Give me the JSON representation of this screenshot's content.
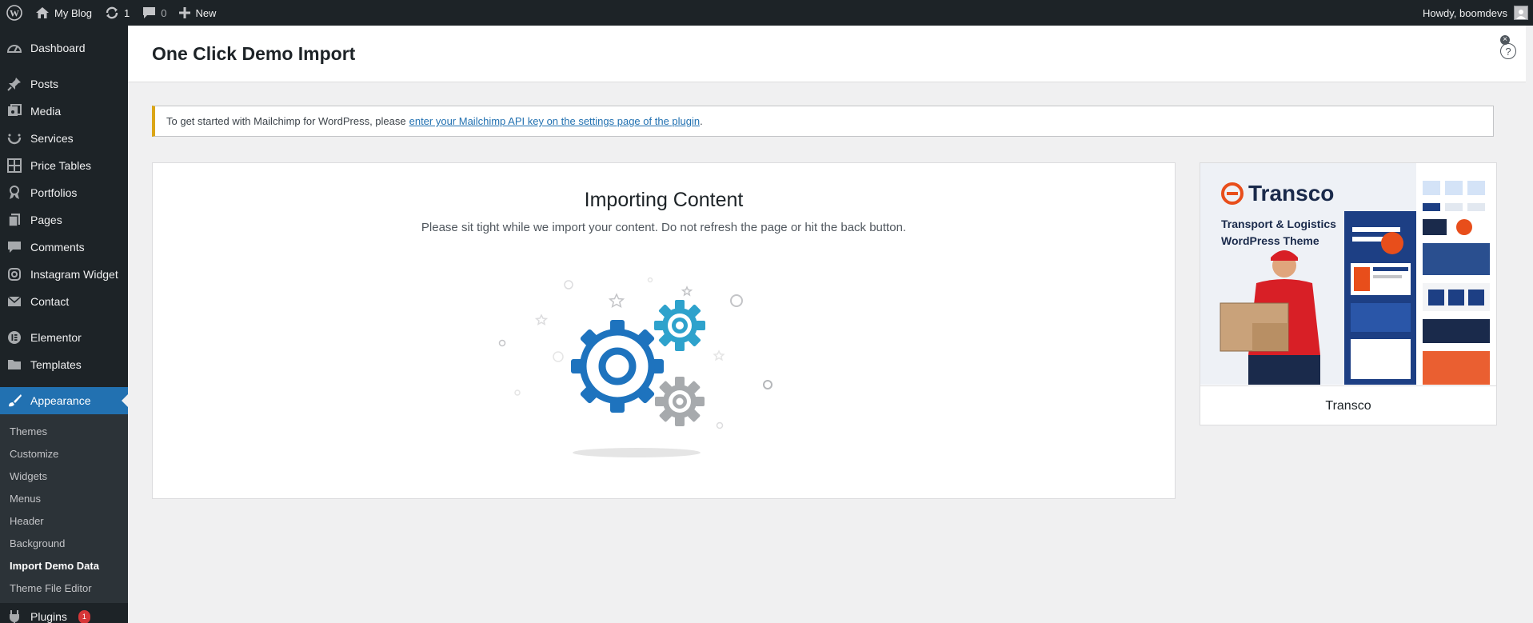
{
  "admin_bar": {
    "site_name": "My Blog",
    "updates_count": "1",
    "comments_count": "0",
    "new_label": "New",
    "howdy": "Howdy, boomdevs"
  },
  "sidebar": {
    "items": [
      {
        "label": "Dashboard",
        "icon": "dashboard-icon"
      },
      {
        "label": "Posts",
        "icon": "pin-icon"
      },
      {
        "label": "Media",
        "icon": "media-icon"
      },
      {
        "label": "Services",
        "icon": "services-icon"
      },
      {
        "label": "Price Tables",
        "icon": "grid-icon"
      },
      {
        "label": "Portfolios",
        "icon": "award-icon"
      },
      {
        "label": "Pages",
        "icon": "pages-icon"
      },
      {
        "label": "Comments",
        "icon": "comment-icon"
      },
      {
        "label": "Instagram Widget",
        "icon": "instagram-icon"
      },
      {
        "label": "Contact",
        "icon": "mail-icon"
      },
      {
        "label": "Elementor",
        "icon": "elementor-icon"
      },
      {
        "label": "Templates",
        "icon": "folder-icon"
      },
      {
        "label": "Appearance",
        "icon": "brush-icon"
      }
    ],
    "submenu": [
      "Themes",
      "Customize",
      "Widgets",
      "Menus",
      "Header",
      "Background",
      "Import Demo Data",
      "Theme File Editor"
    ],
    "plugins_label": "Plugins",
    "plugins_badge": "1"
  },
  "page": {
    "title": "One Click Demo Import",
    "help": "?"
  },
  "notice": {
    "text": "To get started with Mailchimp for WordPress, please",
    "link": "enter your Mailchimp API key on the settings page of the plugin",
    "suffix": "."
  },
  "import": {
    "title": "Importing Content",
    "description": "Please sit tight while we import your content. Do not refresh the page or hit the back button."
  },
  "demo": {
    "name": "Transco",
    "preview_brand": "Transco",
    "preview_tagline": "Transport & Logistics WordPress Theme"
  },
  "colors": {
    "admin_dark": "#1d2327",
    "accent_blue": "#2271b1",
    "notice_warning": "#dba617",
    "gear_blue": "#1e73be",
    "gear_light_blue": "#2ea2cc",
    "gear_gray": "#a7aaad"
  }
}
